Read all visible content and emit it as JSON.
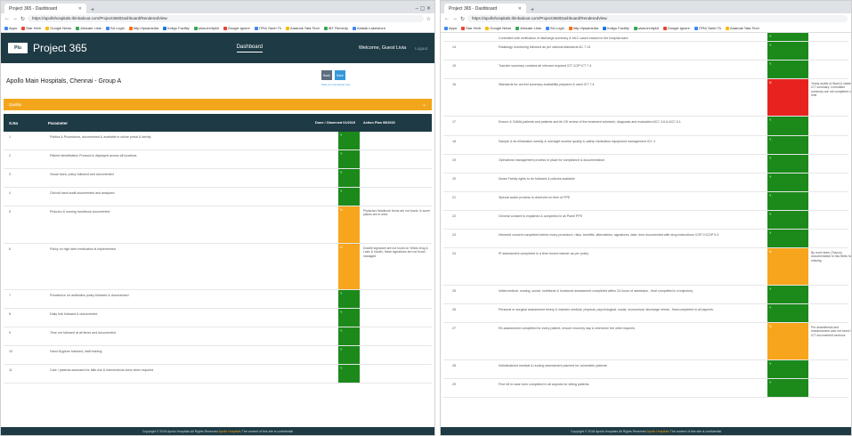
{
  "left_window": {
    "tab_title": "Project 365 - Dashboard",
    "url": "https://apollohospitals.thinkabout.com/Project365/Dashboard/RenderedView",
    "bookmarks": [
      "Apps",
      "Star Herb",
      "Google News",
      "Allocate Lists",
      "SA Login",
      "http://ipsamedia",
      "Indigo Facility",
      "www.trinitykit",
      "Google ignore",
      "ITRA Tamb Tk",
      "Adamak Tata Tech",
      "IBT Remedy",
      "Adalak Lakeshore"
    ],
    "app_title": "Project 365",
    "logo_text": "Plu",
    "nav_dashboard": "Dashboard",
    "welcome_text": "Welcome, Guest Livia",
    "logout": "Logout",
    "site_name": "Apollo Main Hospitals, Chennai - Group A",
    "back_label": "Back",
    "save_label": "Save",
    "save_note": "Save as Completed only",
    "section": "Quality",
    "columns": [
      "S.No",
      "Parameter",
      "Done / Observed 01/2019",
      "Action Plan 05/2019"
    ],
    "rows": [
      {
        "sno": "1",
        "param": "Politics & Procedures, documented & available in online portal & strictly",
        "status": "green",
        "label": "Y",
        "action": ""
      },
      {
        "sno": "2",
        "param": "Patient identification Protocol is displayed across all locations",
        "status": "green",
        "label": "Y",
        "action": ""
      },
      {
        "sno": "3",
        "param": "Visual track, policy followed and documented",
        "status": "green",
        "label": "Y",
        "action": ""
      },
      {
        "sno": "4",
        "param": "Clinical hand audit documented and analyzed",
        "status": "green",
        "label": "Y",
        "action": ""
      },
      {
        "sno": "5",
        "param": "Phsicion & nursing handbook documented",
        "status": "orange",
        "label": "N",
        "action": "Physician Handbook forms are not found, in some places are in work"
      },
      {
        "sno": "6",
        "param": "Policy on high alert medication is implemented",
        "status": "orange",
        "label": "N",
        "action": "Double signature are not found on Yellow drug & Lasix & Insulin, these signatures are not found managed"
      },
      {
        "sno": "7",
        "param": "Prevalence on antibiotics policy followed & documented",
        "status": "green",
        "label": "Y",
        "action": ""
      },
      {
        "sno": "8",
        "param": "Daily hub followed & documented",
        "status": "green",
        "label": "Y",
        "action": ""
      },
      {
        "sno": "9",
        "param": "Time out followed at all times and documented",
        "status": "green",
        "label": "Y",
        "action": ""
      },
      {
        "sno": "10",
        "param": "Hand Hygiene followed, staff training",
        "status": "green",
        "label": "Y",
        "action": ""
      },
      {
        "sno": "11",
        "param": "Care / patients assessed for falls risk & interventions done when required",
        "status": "green",
        "label": "Y",
        "action": ""
      }
    ],
    "footer_prefix": "Copyright © 2018 Apollo Hospitals All Rights Reserved",
    "footer_link": "Apollo Hospitals",
    "footer_suffix": "The content of this site is confidential"
  },
  "right_window": {
    "tab_title": "Project 365 - Dashboard",
    "url": "https://apollohospitals.thinkabout.com/Project365/Dashboard/RenderedView",
    "bookmarks": [
      "Apps",
      "Star Herb",
      "Google News",
      "Allocate Lists",
      "SA Login",
      "http://ipsamedia",
      "Indigo Facility",
      "www.trinitykit",
      "Google ignore",
      "ITRA Tamb Tk",
      "Adamak Tata Tech"
    ],
    "rows": [
      {
        "sno": "",
        "param": "Controlled with verification of discharge summary & MLC cases tracked in the hospital ward",
        "status": "green",
        "label": "Y",
        "action": "",
        "h": 10
      },
      {
        "sno": "14",
        "param": "Radiology monitoring followed as per national standards AC 7.14",
        "status": "green",
        "label": "Y",
        "action": "",
        "h": 21
      },
      {
        "sno": "15",
        "param": "Transfer summary contains all relevant required ICT COP ICT 7.4",
        "status": "green",
        "label": "Y",
        "action": "",
        "h": 21
      },
      {
        "sno": "16",
        "param": "Standards for current summary availability prepared & used ICT 7.4",
        "status": "red",
        "label": "N",
        "action": "Yearly audits of Ward & statement ICT summary. Consultant summary are not completed on time",
        "h": 42
      },
      {
        "sno": "17",
        "param": "Ensure & GAMA patients and patients and its OK review of the treatment schedule, diagnosis and evaluation ACC 3.6 & ACC 6.1",
        "status": "green",
        "label": "Y",
        "action": "",
        "h": 22
      },
      {
        "sno": "18",
        "param": "Sample & its elimination weekly & oversight monitor quality & safety medication equipment management ICC 4",
        "status": "green",
        "label": "Y",
        "action": "",
        "h": 21
      },
      {
        "sno": "19",
        "param": "Operations management process in place for compliance & documentation",
        "status": "green",
        "label": "Y",
        "action": "",
        "h": 21
      },
      {
        "sno": "20",
        "param": "Nurse Family rights to be followed & policies available",
        "status": "green",
        "label": "Y",
        "action": "",
        "h": 21
      },
      {
        "sno": "21",
        "param": "Special action process is observed on time of PPE",
        "status": "green",
        "label": "Y",
        "action": "",
        "h": 21
      },
      {
        "sno": "22",
        "param": "General consent is explained & completed in all Panel PPE",
        "status": "green",
        "label": "Y",
        "action": "",
        "h": 21
      },
      {
        "sno": "23",
        "param": "Informed consent completed before every procedure, risks, benefits, alternatives, signatures, date, time documented with drug instructions COP 9 ICOP 9.3",
        "status": "green",
        "label": "Y",
        "action": "",
        "h": 21
      },
      {
        "sno": "24",
        "param": "IP assessment completed in a time bound manner as per policy",
        "status": "orange",
        "label": "N",
        "action": "By more team (Trayon) documentation is has fields found missing",
        "h": 42
      },
      {
        "sno": "25",
        "param": "Initial medical, nursing, social, nutritional & functional assessment completed within 24 hours of admission - final completed in a trajectory",
        "status": "green",
        "label": "Y",
        "action": "",
        "h": 21
      },
      {
        "sno": "26",
        "param": "Personal re-surgical assessment timely & includes medical, physical, psychological, social, economical, discharge needs - final completed in all aspects",
        "status": "green",
        "label": "Y",
        "action": "",
        "h": 21
      },
      {
        "sno": "27",
        "param": "Re-assessment completed for every patient, ensure recovery day & whenever the other requires",
        "status": "orange",
        "label": "N",
        "action": "Pre anaesthesia and reassessment was not found in ICT documented sections",
        "h": 42
      },
      {
        "sno": "28",
        "param": "Individualized medical & nursing assessment planned for vulnerable patients",
        "status": "green",
        "label": "Y",
        "action": "",
        "h": 21
      },
      {
        "sno": "29",
        "param": "First 48 hr case form completed in all aspects for sitting patients",
        "status": "green",
        "label": "Y",
        "action": "",
        "h": 21
      }
    ],
    "footer_prefix": "Copyright © 2018 Apollo Hospitals All Rights Reserved",
    "footer_link": "Apollo Hospitals",
    "footer_suffix": "The content of this site is confidential"
  },
  "colors": {
    "navy": "#1e3a44",
    "accent": "#f3a61b",
    "green": "#1b8a1b",
    "orange": "#f7a51c",
    "red": "#e8231f",
    "blue": "#3498db"
  }
}
